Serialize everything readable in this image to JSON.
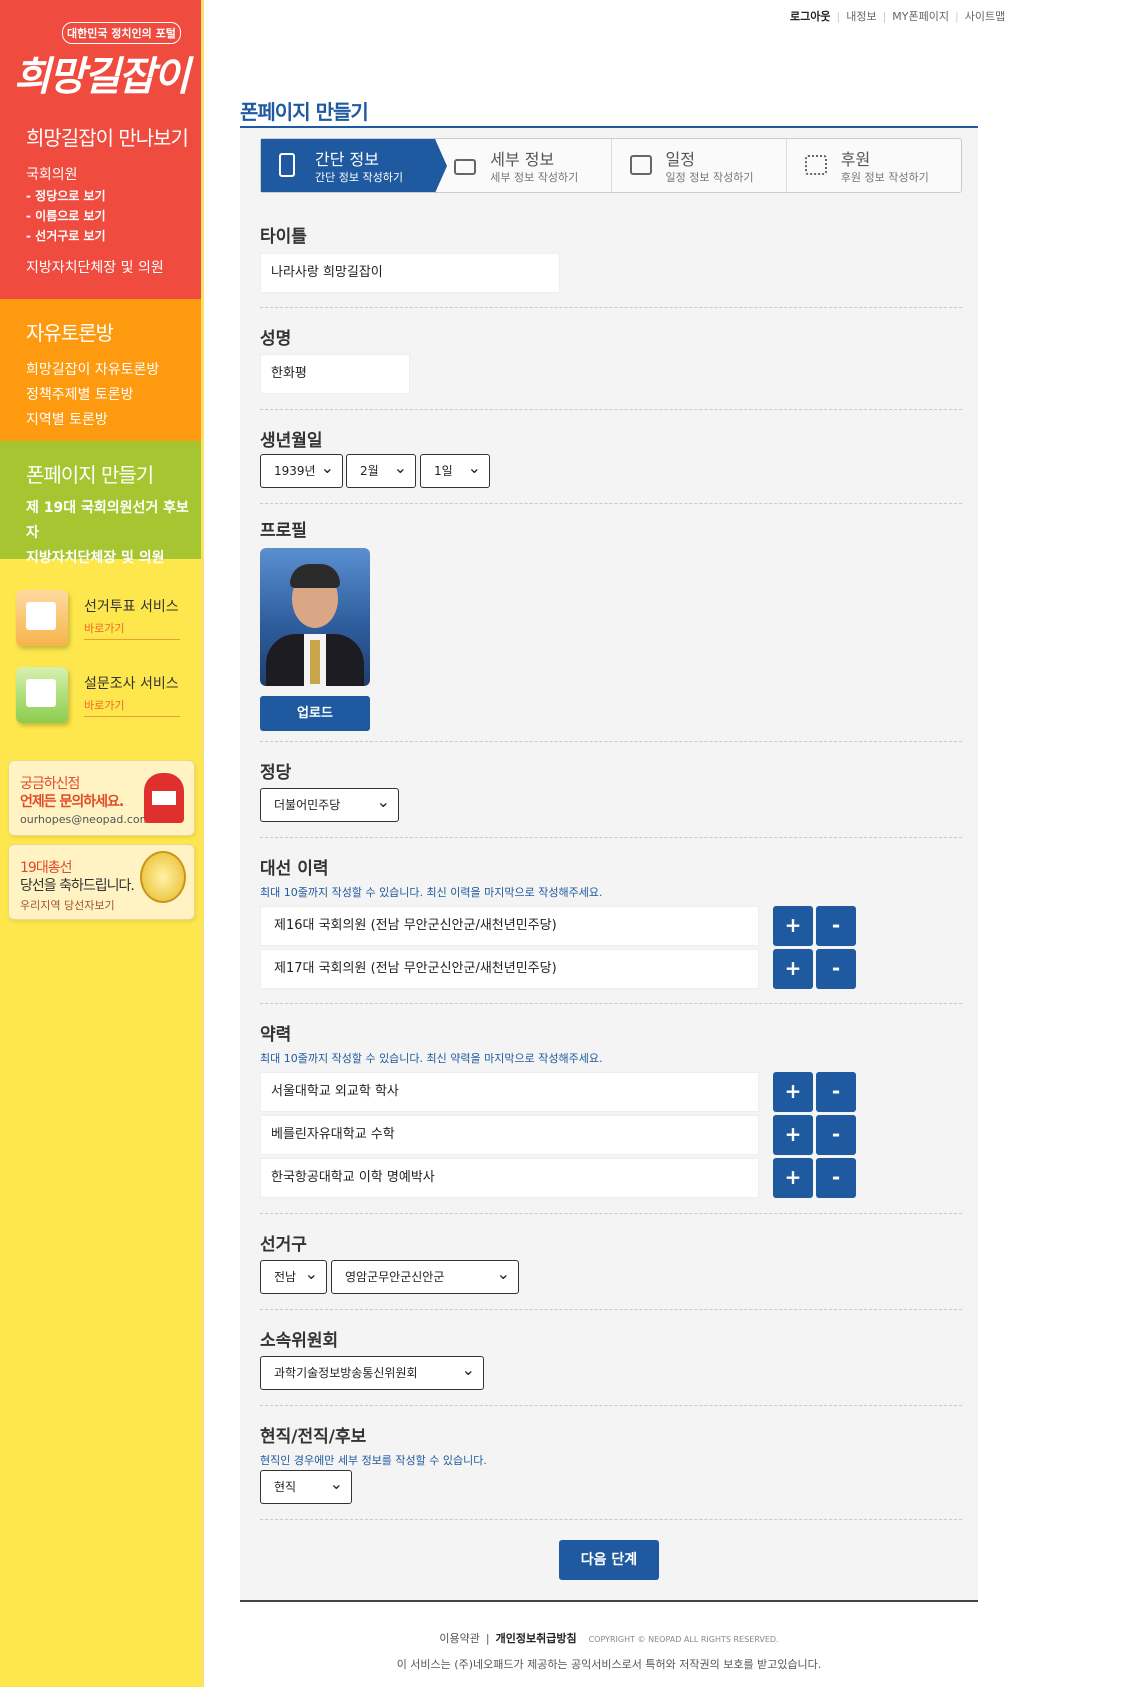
{
  "sidebar": {
    "logo_tag": "대한민국 정치인의 포털",
    "logo_text": "희망길잡이",
    "meet": {
      "title": "희망길잡이 만나보기",
      "link1": "국회의원",
      "sub1": "-  정당으로 보기",
      "sub2": "-  이름으로 보기",
      "sub3": "-  선거구로 보기",
      "link2": "지방자치단체장 및 의원"
    },
    "forum": {
      "title": "자유토론방",
      "link1": "희망길잡이 자유토론방",
      "link2": "정책주제별 토론방",
      "link3": "지역별 토론방"
    },
    "fanpage": {
      "title": "폰페이지 만들기",
      "link1": "제 19대 국회의원선거 후보자",
      "link2": "지방자치단체장 및 의원"
    },
    "services": [
      {
        "title": "선거투표 서비스",
        "go": "바로가기"
      },
      {
        "title": "설문조사 서비스",
        "go": "바로가기"
      }
    ],
    "contact": {
      "line1": "궁금하신점",
      "line2": "언제든 문의하세요.",
      "email": "ourhopes@neopad.com"
    },
    "congrats": {
      "line1": "19대총선",
      "line2": "당선을 축하드립니다.",
      "line3": "우리지역 당선자보기"
    }
  },
  "topnav": {
    "logout": "로그아웃",
    "myinfo": "내정보",
    "mypage": "MY폰페이지",
    "sitemap": "사이트맵"
  },
  "page_title": "폰페이지 만들기",
  "steps": [
    {
      "name": "간단 정보",
      "desc": "간단 정보 작성하기",
      "icon": "phone-icon"
    },
    {
      "name": "세부 정보",
      "desc": "세부 정보 작성하기",
      "icon": "id-card-icon"
    },
    {
      "name": "일정",
      "desc": "일정 정보 작성하기",
      "icon": "calendar-icon"
    },
    {
      "name": "후원",
      "desc": "후원 정보 작성하기",
      "icon": "qr-code-icon"
    }
  ],
  "form": {
    "title_label": "타이틀",
    "title_value": "나라사랑 희망길잡이",
    "name_label": "성명",
    "name_value": "한화평",
    "birth_label": "생년월일",
    "birth_year": "1939년",
    "birth_month": "2월",
    "birth_day": "1일",
    "profile_label": "프로필",
    "upload_button": "업로드",
    "party_label": "정당",
    "party_value": "더불어민주당",
    "election_label": "대선 이력",
    "election_hint": "최대 10줄까지 작성할 수 있습니다. 최신 이력을 마지막으로 작성해주세요.",
    "election_items": [
      "제16대 국회의원 (전남 무안군신안군/새천년민주당)",
      "제17대 국회의원 (전남 무안군신안군/새천년민주당)"
    ],
    "career_label": "약력",
    "career_hint": "최대 10줄까지 작성할 수 있습니다. 최신 약력을 마지막으로 작성해주세요.",
    "career_items": [
      "서울대학교 외교학 학사",
      "베를린자유대학교 수학",
      "한국항공대학교 이학 명예박사"
    ],
    "district_label": "선거구",
    "district_region": "전남",
    "district_value": "영암군무안군신안군",
    "committee_label": "소속위원회",
    "committee_value": "과학기술정보방송통신위원회",
    "status_label": "현직/전직/후보",
    "status_hint": "현직인 경우에만 세부 정보를 작성할 수 있습니다.",
    "status_value": "현직",
    "plus": "+",
    "minus": "-",
    "next_button": "다음 단계"
  },
  "footer": {
    "terms": "이용약관",
    "privacy": "개인정보취급방침",
    "copyright": "COPYRIGHT © NEOPAD ALL RIGHTS RESERVED.",
    "notice": "이 서비스는 (주)네오패드가 제공하는 공익서비스로서 특허와 저작권의 보호를 받고있습니다."
  },
  "colors": {
    "accent": "#1f5aa0",
    "red": "#ef4b3f",
    "orange": "#fd9a0f",
    "green": "#a6c631",
    "yellow": "#fde74c"
  }
}
